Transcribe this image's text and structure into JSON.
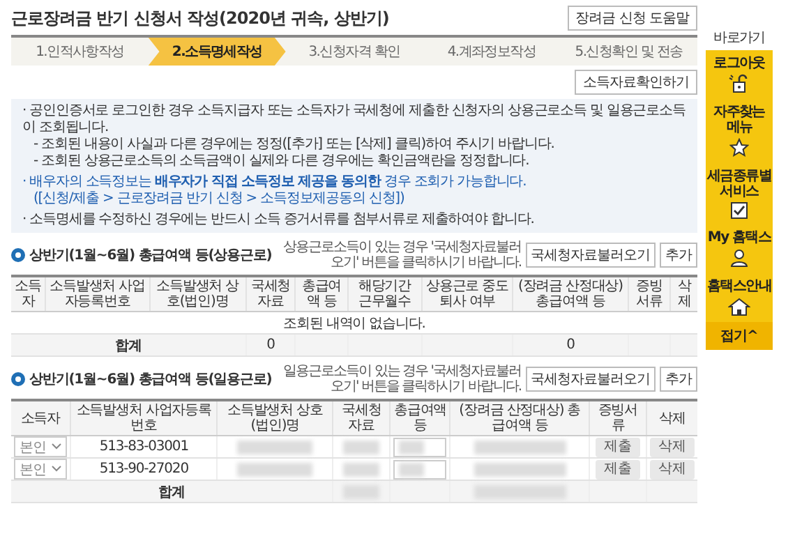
{
  "page": {
    "title": "근로장려금 반기 신청서 작성(2020년 귀속, 상반기)",
    "help_button": "장려금 신청 도움말"
  },
  "steps": [
    {
      "label": "1.인적사항작성",
      "selected": false
    },
    {
      "label": "2.소득명세작성",
      "selected": true
    },
    {
      "label": "3.신청자격 확인",
      "selected": false
    },
    {
      "label": "4.계좌정보작성",
      "selected": false
    },
    {
      "label": "5.신청확인 및 전송",
      "selected": false
    }
  ],
  "confirm_button": "소득자료확인하기",
  "notices": [
    {
      "kind": "bullet",
      "text": "· 공인인증서로 로그인한 경우 소득지급자 또는 소득자가 국세청에 제출한 신청자의 상용근로소득 및 일용근로소득이 조회됩니다."
    },
    {
      "kind": "sub",
      "text": "- 조회된 내용이 사실과 다른 경우에는 정정([추가] 또는 [삭제] 클릭)하여 주시기 바랍니다."
    },
    {
      "kind": "sub",
      "text": "- 조회된 상용근로소득의 소득금액이 실제와 다른 경우에는 확인금액란을 정정합니다."
    },
    {
      "kind": "accent",
      "text": "· 배우자의 소득정보는 **배우자가 직접 소득정보 제공을 동의한** 경우 조회가 가능합니다."
    },
    {
      "kind": "accent-sub",
      "text": "([신청/제출 > 근로장려금 반기 신청 > 소득정보제공동의 신청])"
    },
    {
      "kind": "bullet",
      "text": "· 소득명세를 수정하신 경우에는 반드시 소득 증거서류를 첨부서류로 제출하여야 합니다."
    }
  ],
  "sections": [
    {
      "title": "상반기(1월~6월) 총급여액 등(상용근로)",
      "hint": "상용근로소득이 있는 경우 '국세청자료불러오기' 버튼을 클릭하시기 바랍니다.",
      "buttons": [
        "국세청자료불러오기",
        "추가"
      ],
      "columns": [
        "소득자",
        "소득발생처 사업자등록번호",
        "소득발생처 상호(법인)명",
        "국세청자료",
        "총급여액 등",
        "해당기간 근무월수",
        "상용근로 중도퇴사 여부",
        "(장려금 산정대상) 총급여액 등",
        "증빙서류",
        "삭제"
      ],
      "empty_message": "조회된 내역이 없습니다.",
      "total": {
        "label": "합계",
        "cells": [
          {
            "kind": "text",
            "value": "0"
          },
          {
            "kind": "empty"
          },
          {
            "kind": "empty"
          },
          {
            "kind": "empty"
          },
          {
            "kind": "text",
            "value": "0"
          },
          {
            "kind": "empty"
          },
          {
            "kind": "empty"
          }
        ]
      }
    },
    {
      "title": "상반기(1월~6월) 총급여액 등(일용근로)",
      "hint": "일용근로소득이 있는 경우 '국세청자료불러오기' 버튼을 클릭하시기 바랍니다.",
      "buttons": [
        "국세청자료불러오기",
        "추가"
      ],
      "columns": [
        "소득자",
        "소득발생처 사업자등록번호",
        "소득발생처 상호(법인)명",
        "국세청자료",
        "총급여액 등",
        "(장려금 산정대상) 총급여액 등",
        "증빙서류",
        "삭제"
      ],
      "rows": [
        [
          {
            "kind": "select",
            "value": "본인"
          },
          {
            "kind": "text",
            "value": "513-83-03001"
          },
          {
            "kind": "redacted"
          },
          {
            "kind": "redacted"
          },
          {
            "kind": "input"
          },
          {
            "kind": "redacted"
          },
          {
            "kind": "button",
            "value": "제출"
          },
          {
            "kind": "button",
            "value": "삭제"
          }
        ],
        [
          {
            "kind": "select",
            "value": "본인"
          },
          {
            "kind": "text",
            "value": "513-90-27020"
          },
          {
            "kind": "redacted"
          },
          {
            "kind": "redacted"
          },
          {
            "kind": "input"
          },
          {
            "kind": "redacted"
          },
          {
            "kind": "button",
            "value": "제출"
          },
          {
            "kind": "button",
            "value": "삭제"
          }
        ]
      ],
      "total": {
        "label": "합계",
        "cells": [
          {
            "kind": "redacted"
          },
          {
            "kind": "empty"
          },
          {
            "kind": "redacted"
          },
          {
            "kind": "empty"
          },
          {
            "kind": "empty"
          }
        ]
      }
    }
  ],
  "sidebar": {
    "title": "바로가기",
    "items": [
      "로그아웃",
      "자주찾는 메뉴",
      "세금종류별 서비스",
      "My 홈택스",
      "홈택스안내"
    ],
    "collapse": "접기^"
  }
}
